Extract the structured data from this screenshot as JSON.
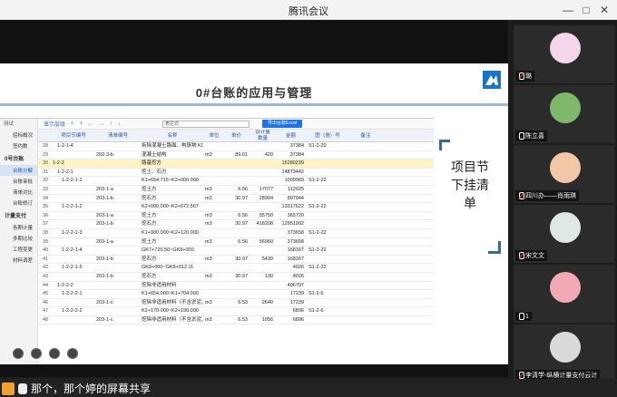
{
  "window": {
    "title": "腾讯会议",
    "controls": [
      "—",
      "□",
      "✕"
    ]
  },
  "slide": {
    "title": "0#台账的应用与管理",
    "right_text": "项目节下挂清单",
    "app": {
      "header_label": "测试",
      "toolbar": [
        "显示层级",
        "+",
        "+",
        "←",
        "→",
        "↑",
        "↓"
      ],
      "formula_label": "表达式",
      "export_label": "导出台账Excel",
      "sidebar": {
        "items": [
          {
            "label": "招标概况",
            "group": false
          },
          {
            "label": "签约数",
            "group": false
          },
          {
            "label": "0号台账",
            "group": true
          },
          {
            "label": "台账分解",
            "group": false,
            "active": true
          },
          {
            "label": "台账审批",
            "group": false
          },
          {
            "label": "清单对比",
            "group": false
          },
          {
            "label": "台账修订",
            "group": false
          },
          {
            "label": "计量支付",
            "group": true
          },
          {
            "label": "各期计量",
            "group": false
          },
          {
            "label": "多期比较",
            "group": false
          },
          {
            "label": "工程变更",
            "group": false
          },
          {
            "label": "材料调差",
            "group": false
          }
        ]
      },
      "columns": [
        "项目节编号",
        "清单编号",
        "名称",
        "单位",
        "单价",
        "数量",
        "金额",
        "图（册）号",
        "备注"
      ],
      "columns_group": "设计量",
      "rows": [
        {
          "no": "28",
          "code": "1-2-1-4",
          "list": "",
          "name": "拆除混凝土路面、构筑物 K0+000",
          "unit": "",
          "price": "",
          "qty": "",
          "amt": "37384",
          "tu": "S1-2-20",
          "note": ""
        },
        {
          "no": "29",
          "code": "",
          "list": "202-3-b",
          "name": "混凝土结构",
          "unit": "m3",
          "price": "89.01",
          "qty": "420",
          "amt": "37384",
          "tu": "",
          "note": ""
        },
        {
          "no": "30",
          "code": "1-2-2",
          "list": "",
          "name": "路基挖方",
          "unit": "",
          "price": "",
          "qty": "",
          "amt": "15280239",
          "tu": "",
          "note": "",
          "selected": true
        },
        {
          "no": "31",
          "code": "1-2-2-1",
          "list": "",
          "name": "挖土、石方",
          "unit": "",
          "price": "",
          "qty": "",
          "amt": "14873442",
          "tu": "",
          "note": ""
        },
        {
          "no": "32",
          "code": "1-2-2-1-1",
          "list": "",
          "name": "K1+654.715~K2+000.000",
          "unit": "",
          "price": "",
          "qty": "",
          "amt": "1009969",
          "tu": "S1-2-22",
          "note": ""
        },
        {
          "no": "33",
          "code": "",
          "list": "203-1-a",
          "name": "挖土方",
          "unit": "m3",
          "price": "6.56",
          "qty": "17077",
          "amt": "112025",
          "tu": "",
          "note": ""
        },
        {
          "no": "34",
          "code": "",
          "list": "203-1-b",
          "name": "挖石方",
          "unit": "m3",
          "price": "30.97",
          "qty": "28994",
          "amt": "897944",
          "tu": "",
          "note": ""
        },
        {
          "no": "35",
          "code": "1-2-2-1-2",
          "list": "",
          "name": "K2+000.000~K2+672.567",
          "unit": "",
          "price": "",
          "qty": "",
          "amt": "13317622",
          "tu": "S1-2-22",
          "note": ""
        },
        {
          "no": "36",
          "code": "",
          "list": "203-1-a",
          "name": "挖土方",
          "unit": "m3",
          "price": "6.56",
          "qty": "55750",
          "amt": "365720",
          "tu": "",
          "note": ""
        },
        {
          "no": "37",
          "code": "",
          "list": "203-1-b",
          "name": "挖石方",
          "unit": "m3",
          "price": "30.97",
          "qty": "418208",
          "amt": "12951902",
          "tu": "",
          "note": ""
        },
        {
          "no": "38",
          "code": "1-2-2-1-3",
          "list": "",
          "name": "K1+900.000~K2+120.000",
          "unit": "",
          "price": "",
          "qty": "",
          "amt": "373658",
          "tu": "S1-2-22",
          "note": ""
        },
        {
          "no": "39",
          "code": "",
          "list": "203-1-a",
          "name": "挖土方",
          "unit": "m3",
          "price": "6.56",
          "qty": "56960",
          "amt": "373658",
          "tu": "",
          "note": ""
        },
        {
          "no": "40",
          "code": "1-2-2-1-4",
          "list": "",
          "name": "GK7+725.50~GK8+000",
          "unit": "",
          "price": "",
          "qty": "",
          "amt": "168167",
          "tu": "S1-2-22",
          "note": ""
        },
        {
          "no": "41",
          "code": "",
          "list": "203-1-b",
          "name": "挖石方",
          "unit": "m3",
          "price": "30.97",
          "qty": "5430",
          "amt": "168167",
          "tu": "",
          "note": ""
        },
        {
          "no": "42",
          "code": "1-2-2-1-5",
          "list": "",
          "name": "GK8+000~GK8+012.11",
          "unit": "",
          "price": "",
          "qty": "",
          "amt": "4026",
          "tu": "S1-2-22",
          "note": ""
        },
        {
          "no": "43",
          "code": "",
          "list": "203-1-b",
          "name": "挖石方",
          "unit": "m3",
          "price": "30.97",
          "qty": "130",
          "amt": "4026",
          "tu": "",
          "note": ""
        },
        {
          "no": "44",
          "code": "1-2-2-2",
          "list": "",
          "name": "挖除非适用材料",
          "unit": "",
          "price": "",
          "qty": "",
          "amt": "406797",
          "tu": "",
          "note": ""
        },
        {
          "no": "45",
          "code": "1-2-2-2-1",
          "list": "",
          "name": "K1+654.000~K1+704.000",
          "unit": "",
          "price": "",
          "qty": "",
          "amt": "17239",
          "tu": "S1-2-6",
          "note": ""
        },
        {
          "no": "46",
          "code": "",
          "list": "203-1-c",
          "name": "挖除非适用材料（不含淤泥、岩",
          "unit": "m3",
          "price": "6.53",
          "qty": "2640",
          "amt": "17239",
          "tu": "",
          "note": ""
        },
        {
          "no": "47",
          "code": "1-2-2-2-2",
          "list": "",
          "name": "K2+170.000~K2+190.000",
          "unit": "",
          "price": "",
          "qty": "",
          "amt": "6896",
          "tu": "S1-2-6",
          "note": ""
        },
        {
          "no": "48",
          "code": "",
          "list": "203-1-c",
          "name": "挖除非适用材料（不含淤泥、岩",
          "unit": "m3",
          "price": "6.53",
          "qty": "1056",
          "amt": "6896",
          "tu": "",
          "note": ""
        }
      ]
    }
  },
  "share_banner": "那个，那个婷的屏幕共享",
  "participants": [
    {
      "name": "璐",
      "muted": true,
      "avatar_color": "#f4d6ea"
    },
    {
      "name": "陈立喜",
      "muted": false,
      "avatar_color": "#7fb86a"
    },
    {
      "name": "四川办——肖雨琪",
      "muted": true,
      "avatar_color": "#f1c7a8"
    },
    {
      "name": "宋文文",
      "muted": true,
      "avatar_color": "#dfe9e3"
    },
    {
      "name": "1",
      "muted": false,
      "avatar_color": "#f2a9b6"
    },
    {
      "name": "李清学-纵横计量支付云计",
      "muted": true,
      "avatar_color": "#d9d9d9"
    }
  ]
}
